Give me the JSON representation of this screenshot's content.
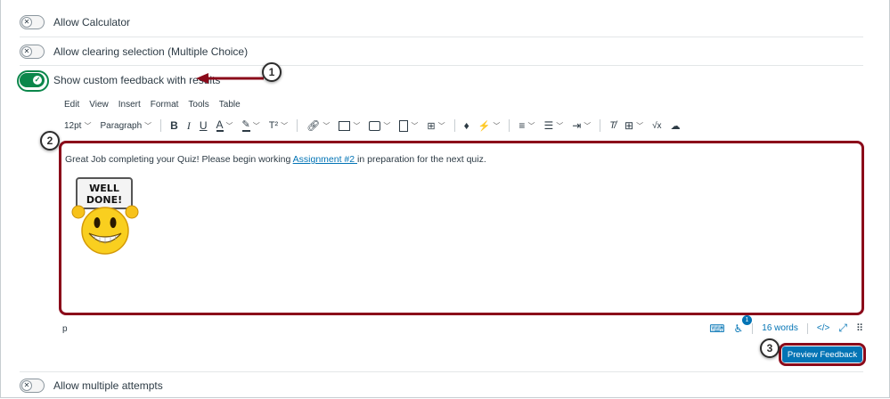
{
  "options": [
    {
      "label": "Allow Calculator",
      "enabled": false
    },
    {
      "label": "Allow clearing selection (Multiple Choice)",
      "enabled": false
    },
    {
      "label": "Show custom feedback with results",
      "enabled": true
    },
    {
      "label": "Allow multiple attempts",
      "enabled": false
    }
  ],
  "editor": {
    "menu": [
      "Edit",
      "View",
      "Insert",
      "Format",
      "Tools",
      "Table"
    ],
    "font_size": "12pt",
    "block_format": "Paragraph",
    "content": {
      "text_before": "Great Job completing your Quiz! Please begin working ",
      "link_text": "Assignment #2 ",
      "text_after": "in preparation for the next quiz.",
      "image_text_line1": "WELL",
      "image_text_line2": "DONE!"
    },
    "path": "p",
    "word_count": "16 words",
    "a11y_issues": "1",
    "html_toggle": "</>"
  },
  "preview_button": "Preview Feedback",
  "callouts": [
    "1",
    "2",
    "3"
  ],
  "colors": {
    "accent_green": "#0b874b",
    "link_blue": "#0374b5",
    "highlight_red": "#8b0a1a"
  }
}
